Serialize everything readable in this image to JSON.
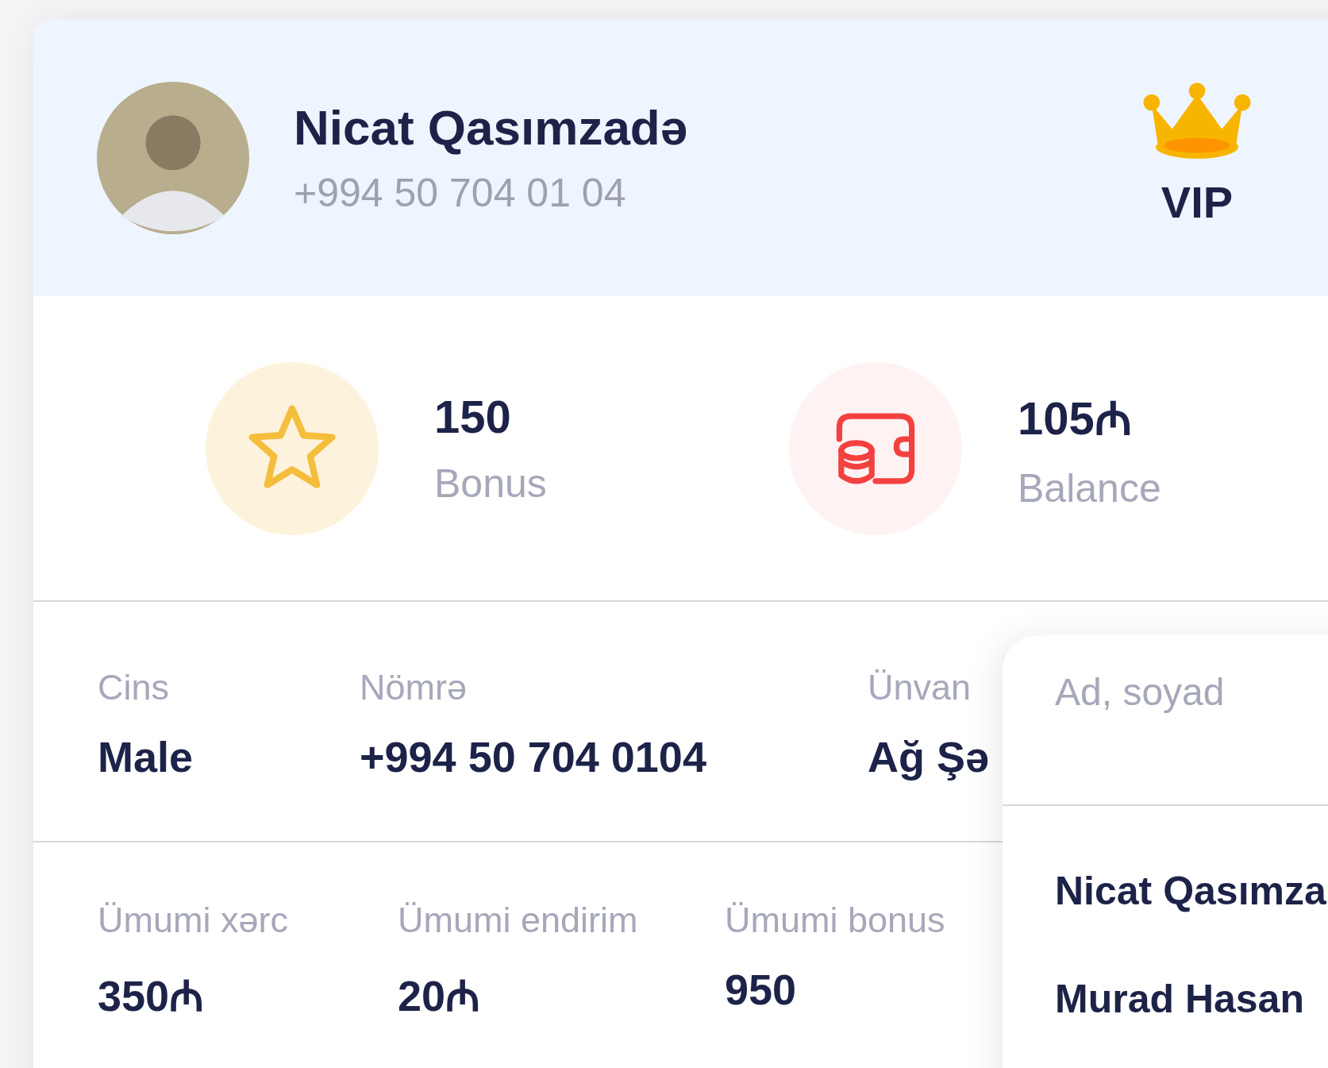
{
  "profile": {
    "name": "Nicat Qasımzadə",
    "phone": "+994 50 704 01 04",
    "tier": "VIP"
  },
  "stats": [
    {
      "kind": "bonus",
      "value": "150",
      "label": "Bonus"
    },
    {
      "kind": "balance",
      "value": "105₼",
      "label": "Balance"
    }
  ],
  "details": [
    {
      "label": "Cins",
      "value": "Male"
    },
    {
      "label": "Nömrə",
      "value": "+994 50 704 0104"
    },
    {
      "label": "Ünvan",
      "value": "Ağ Şə"
    }
  ],
  "totals": [
    {
      "label": "Ümumi xərc",
      "value": "350₼"
    },
    {
      "label": "Ümumi endirim",
      "value": "20₼"
    },
    {
      "label": "Ümumi bonus",
      "value": "950"
    }
  ],
  "dropdown": {
    "placeholder": "Ad, soyad",
    "options": [
      {
        "label": "Nicat Qasımza"
      },
      {
        "label": "Murad Hasan"
      }
    ]
  }
}
